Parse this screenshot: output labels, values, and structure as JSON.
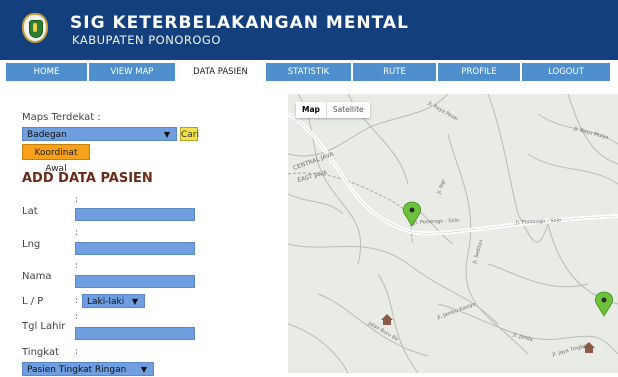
{
  "header": {
    "title": "SIG KETERBELAKANGAN MENTAL",
    "subtitle": "KABUPATEN PONOROGO"
  },
  "nav": {
    "tabs": [
      {
        "label": "HOME",
        "active": false
      },
      {
        "label": "VIEW MAP",
        "active": false
      },
      {
        "label": "DATA PASIEN",
        "active": true
      },
      {
        "label": "STATISTIK",
        "active": false
      },
      {
        "label": "RUTE",
        "active": false
      },
      {
        "label": "PROFILE",
        "active": false
      },
      {
        "label": "LOGOUT",
        "active": false
      }
    ]
  },
  "search": {
    "label": "Maps Terdekat :",
    "selected": "Badegan",
    "cari_label": "Cari",
    "koordinat_label": "Koordinat Awal"
  },
  "form": {
    "title": "ADD DATA PASIEN",
    "colon": ":",
    "lat_label": "Lat",
    "lng_label": "Lng",
    "nama_label": "Nama",
    "lp_label": "L / P",
    "lp_selected": "Laki-laki",
    "tgl_label": "Tgl Lahir",
    "tingkat_label": "Tingkat",
    "tingkat_selected": "Pasien Tingkat Ringan"
  },
  "map": {
    "type_map": "Map",
    "type_satellite": "Satellite",
    "labels": {
      "road_ponorogo": "Jl. Ponorogo - Solo",
      "road_ponorogo2": "Jl. Ponorogo - Solo",
      "central_java": "CENTRAL JAVA",
      "east_java": "EAST JAVA",
      "jl_pasar": "Jl. Raya Pasar",
      "jl_jambu": "Jl. Jambu Kaniyo",
      "jl_janda": "Jl. Janda",
      "jl_jaya": "Jl. Jaya Tingkat",
      "jl_jalan_jb": "Jalan Buru Ba",
      "jl_ngr": "Jl. Ngr",
      "jl_sedayu": "Jl. Sedayu",
      "jl_bayu": "Jl. Bayu Mulyo"
    },
    "colors": {
      "marker": "#6ec13a",
      "road_main": "#ffffff",
      "road_minor": "#b8bcb2",
      "land": "#e9ebe6"
    }
  },
  "colors": {
    "header_bg": "#13407c",
    "nav_tab": "#4f8fce",
    "input_bg": "#6f9fe0",
    "cari": "#f4e24d",
    "koordinat": "#f7a01a",
    "section_title": "#6b2a18"
  }
}
